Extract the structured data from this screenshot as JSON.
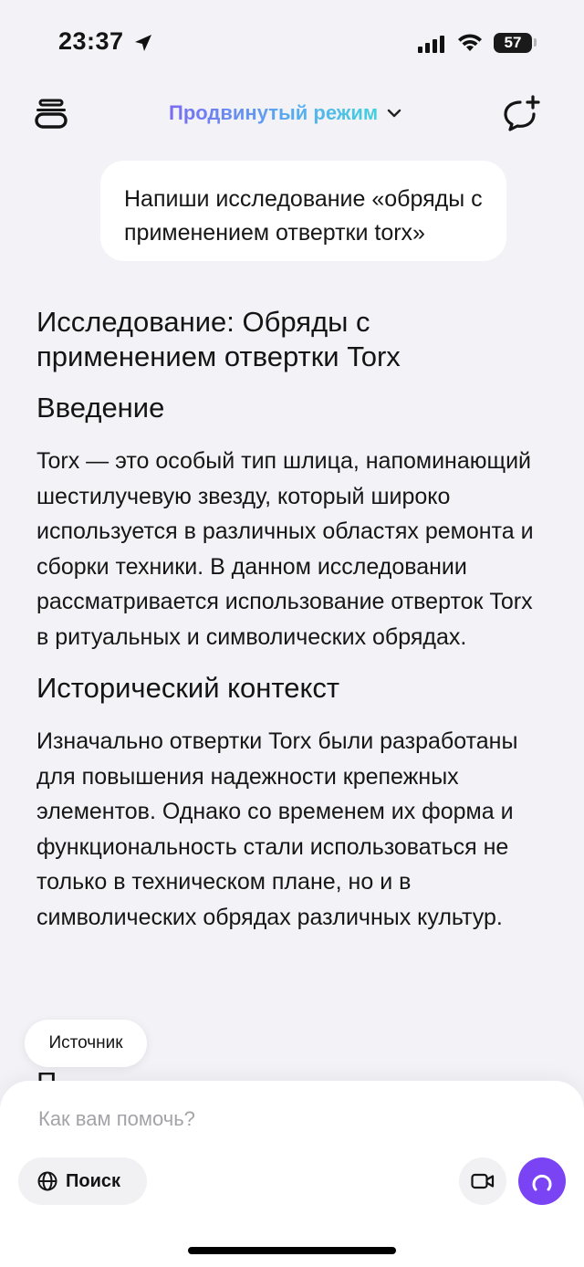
{
  "status_bar": {
    "time": "23:37",
    "battery": "57",
    "icons": [
      "location-arrow-icon",
      "cellular-signal-icon",
      "wifi-icon",
      "battery-icon"
    ]
  },
  "header": {
    "mode_label": "Продвинутый режим",
    "icons": [
      "menu-icon",
      "chevron-down-icon",
      "new-chat-icon"
    ]
  },
  "chat": {
    "user_message": "Напиши исследование «обряды с применением отвертки torx»",
    "answer": {
      "title": "Исследование: Обряды с применением отвертки Torx",
      "sections": [
        {
          "heading": "Введение",
          "text": "Torx — это особый тип шлица, напоминающий шестилучевую звезду, который широко используется в различных областях ремонта и сборки техники. В данном исследовании рассматривается использование отверток Torx в ритуальных и символических обрядах."
        },
        {
          "heading": "Исторический контекст",
          "text": "Изначально отвертки Torx были разработаны для повышения надежности крепежных элементов. Однако со временем их форма и функциональность стали использоваться не только в техническом плане, но и в символических обрядах различных культур."
        }
      ]
    },
    "source_chip": "Источник",
    "next_heading_stub": "П"
  },
  "composer": {
    "placeholder": "Как вам помочь?",
    "search_label": "Поиск",
    "icons": [
      "globe-icon",
      "video-camera-icon",
      "alice-assistant-icon"
    ],
    "accent_color": "#7a44f5"
  }
}
